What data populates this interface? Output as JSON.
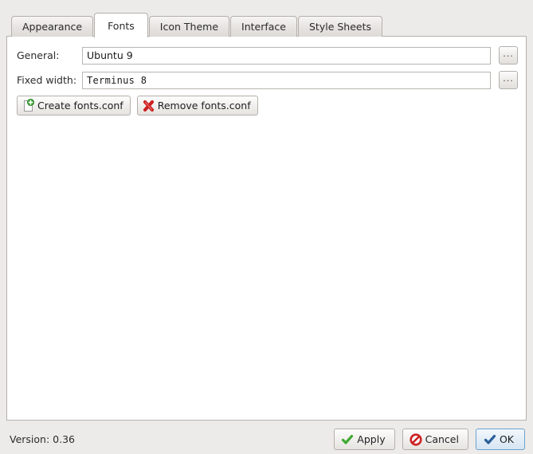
{
  "tabs": [
    {
      "label": "Appearance",
      "active": false
    },
    {
      "label": "Fonts",
      "active": true
    },
    {
      "label": "Icon Theme",
      "active": false
    },
    {
      "label": "Interface",
      "active": false
    },
    {
      "label": "Style Sheets",
      "active": false
    }
  ],
  "fonts": {
    "general": {
      "label": "General:",
      "value": "Ubuntu 9",
      "browse_label": "..."
    },
    "fixed_width": {
      "label": "Fixed width:",
      "value": "Terminus 8",
      "browse_label": "..."
    },
    "create_button": {
      "label": "Create  fonts.conf",
      "icon": "new-document-icon"
    },
    "remove_button": {
      "label": "Remove fonts.conf",
      "icon": "delete-x-icon"
    }
  },
  "footer": {
    "version": "Version: 0.36",
    "apply": {
      "label": "Apply",
      "icon": "check-icon"
    },
    "cancel": {
      "label": "Cancel",
      "icon": "prohibition-icon"
    },
    "ok": {
      "label": "OK",
      "icon": "check-icon"
    }
  },
  "colors": {
    "window_bg": "#edebe9",
    "panel_bg": "#ffffff",
    "border": "#b4b0ac",
    "accent_blue": "#6aa2d0",
    "ok_check": "#2a6099",
    "apply_check": "#3faa35",
    "cancel_red": "#cc2222",
    "add_green": "#3faa35",
    "remove_red": "#cc2020"
  }
}
